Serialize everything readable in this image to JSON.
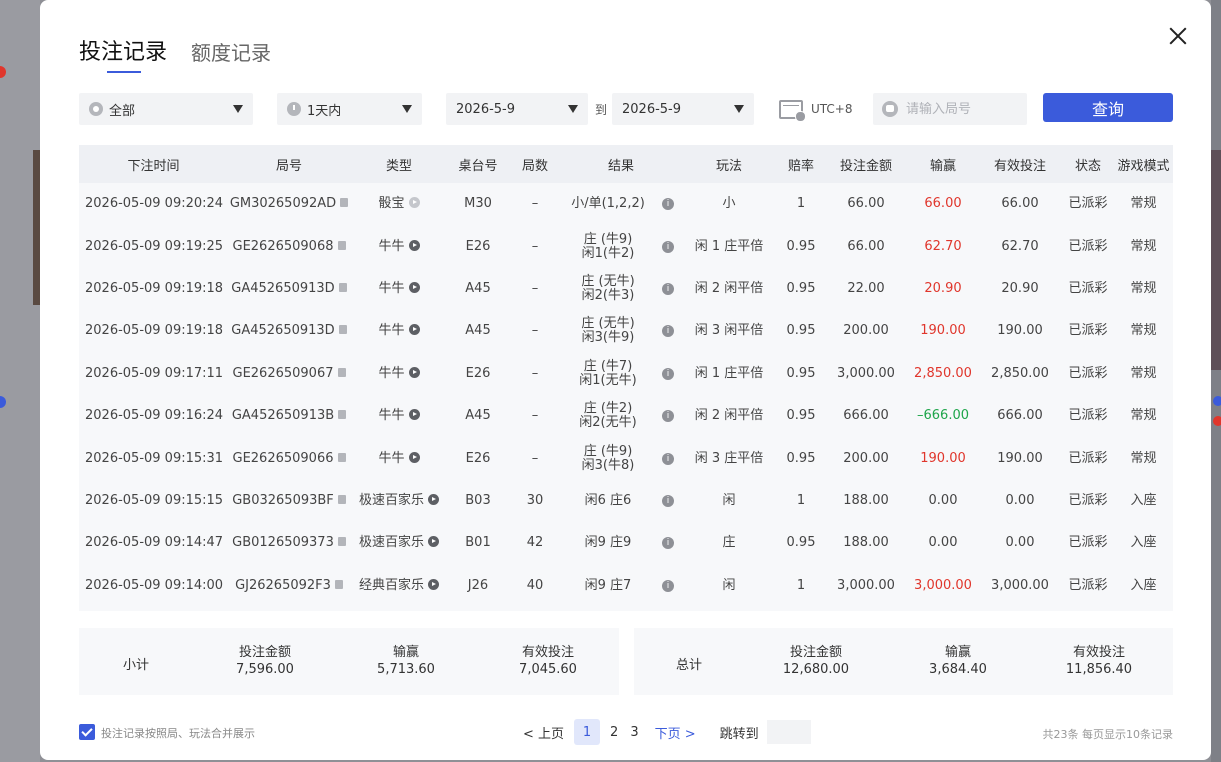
{
  "tabs": [
    "投注记录",
    "额度记录"
  ],
  "filters": {
    "type": "全部",
    "range": "1天内",
    "date_from": "2026-5-9",
    "to_label": "到",
    "date_to": "2026-5-9",
    "timezone": "UTC+8",
    "round_placeholder": "请输入局号",
    "query_label": "查询"
  },
  "table": {
    "headers": [
      "下注时间",
      "局号",
      "类型",
      "桌台号",
      "局数",
      "结果",
      "玩法",
      "赔率",
      "投注金额",
      "输赢",
      "有效投注",
      "状态",
      "游戏模式"
    ],
    "rows": [
      {
        "time": "2026-05-09 09:20:24",
        "round": "GM30265092AD",
        "type": "骰宝",
        "play_style": "light",
        "table": "M30",
        "count": "–",
        "result1": "小/单(1,2,2)",
        "result2": "",
        "bet": "小",
        "odds": "1",
        "amount": "66.00",
        "win": "66.00",
        "win_color": "red",
        "valid": "66.00",
        "status": "已派彩",
        "mode": "常规"
      },
      {
        "time": "2026-05-09 09:19:25",
        "round": "GE2626509068",
        "type": "牛牛",
        "play_style": "dark",
        "table": "E26",
        "count": "–",
        "result1": "庄 (牛9)",
        "result2": "闲1(牛2)",
        "bet": "闲 1 庄平倍",
        "odds": "0.95",
        "amount": "66.00",
        "win": "62.70",
        "win_color": "red",
        "valid": "62.70",
        "status": "已派彩",
        "mode": "常规"
      },
      {
        "time": "2026-05-09 09:19:18",
        "round": "GA452650913D",
        "type": "牛牛",
        "play_style": "dark",
        "table": "A45",
        "count": "–",
        "result1": "庄 (无牛)",
        "result2": "闲2(牛3)",
        "bet": "闲 2 闲平倍",
        "odds": "0.95",
        "amount": "22.00",
        "win": "20.90",
        "win_color": "red",
        "valid": "20.90",
        "status": "已派彩",
        "mode": "常规"
      },
      {
        "time": "2026-05-09 09:19:18",
        "round": "GA452650913D",
        "type": "牛牛",
        "play_style": "dark",
        "table": "A45",
        "count": "–",
        "result1": "庄 (无牛)",
        "result2": "闲3(牛9)",
        "bet": "闲 3 闲平倍",
        "odds": "0.95",
        "amount": "200.00",
        "win": "190.00",
        "win_color": "red",
        "valid": "190.00",
        "status": "已派彩",
        "mode": "常规"
      },
      {
        "time": "2026-05-09 09:17:11",
        "round": "GE2626509067",
        "type": "牛牛",
        "play_style": "dark",
        "table": "E26",
        "count": "–",
        "result1": "庄 (牛7)",
        "result2": "闲1(无牛)",
        "bet": "闲 1 庄平倍",
        "odds": "0.95",
        "amount": "3,000.00",
        "win": "2,850.00",
        "win_color": "red",
        "valid": "2,850.00",
        "status": "已派彩",
        "mode": "常规"
      },
      {
        "time": "2026-05-09 09:16:24",
        "round": "GA452650913B",
        "type": "牛牛",
        "play_style": "dark",
        "table": "A45",
        "count": "–",
        "result1": "庄 (牛2)",
        "result2": "闲2(无牛)",
        "bet": "闲 2 闲平倍",
        "odds": "0.95",
        "amount": "666.00",
        "win": "–666.00",
        "win_color": "green",
        "valid": "666.00",
        "status": "已派彩",
        "mode": "常规"
      },
      {
        "time": "2026-05-09 09:15:31",
        "round": "GE2626509066",
        "type": "牛牛",
        "play_style": "dark",
        "table": "E26",
        "count": "–",
        "result1": "庄 (牛9)",
        "result2": "闲3(牛8)",
        "bet": "闲 3 庄平倍",
        "odds": "0.95",
        "amount": "200.00",
        "win": "190.00",
        "win_color": "red",
        "valid": "190.00",
        "status": "已派彩",
        "mode": "常规"
      },
      {
        "time": "2026-05-09 09:15:15",
        "round": "GB03265093BF",
        "type": "极速百家乐",
        "play_style": "dark",
        "table": "B03",
        "count": "30",
        "result1": "闲6 庄6",
        "result2": "",
        "bet": "闲",
        "odds": "1",
        "amount": "188.00",
        "win": "0.00",
        "win_color": "normal",
        "valid": "0.00",
        "status": "已派彩",
        "mode": "入座"
      },
      {
        "time": "2026-05-09 09:14:47",
        "round": "GB0126509373",
        "type": "极速百家乐",
        "play_style": "dark",
        "table": "B01",
        "count": "42",
        "result1": "闲9 庄9",
        "result2": "",
        "bet": "庄",
        "odds": "0.95",
        "amount": "188.00",
        "win": "0.00",
        "win_color": "normal",
        "valid": "0.00",
        "status": "已派彩",
        "mode": "入座"
      },
      {
        "time": "2026-05-09 09:14:00",
        "round": "GJ26265092F3",
        "type": "经典百家乐",
        "play_style": "dark",
        "table": "J26",
        "count": "40",
        "result1": "闲9 庄7",
        "result2": "",
        "bet": "闲",
        "odds": "1",
        "amount": "3,000.00",
        "win": "3,000.00",
        "win_color": "red",
        "valid": "3,000.00",
        "status": "已派彩",
        "mode": "入座"
      }
    ]
  },
  "subtotal": {
    "label": "小计",
    "amount_label": "投注金额",
    "amount": "7,596.00",
    "win_label": "输赢",
    "win": "5,713.60",
    "valid_label": "有效投注",
    "valid": "7,045.60"
  },
  "total": {
    "label": "总计",
    "amount_label": "投注金额",
    "amount": "12,680.00",
    "win_label": "输赢",
    "win": "3,684.40",
    "valid_label": "有效投注",
    "valid": "11,856.40"
  },
  "footer": {
    "merge_label": "投注记录按照局、玩法合并展示",
    "prev": "< 上页",
    "pages": [
      "1",
      "2",
      "3"
    ],
    "current_page": "1",
    "next": "下页 >",
    "jump_label": "跳转到",
    "total_info": "共23条  每页显示10条记录"
  },
  "colors": {
    "accent": "#3b5bdb",
    "win": "#e0362c",
    "loss": "#1ea54a"
  }
}
